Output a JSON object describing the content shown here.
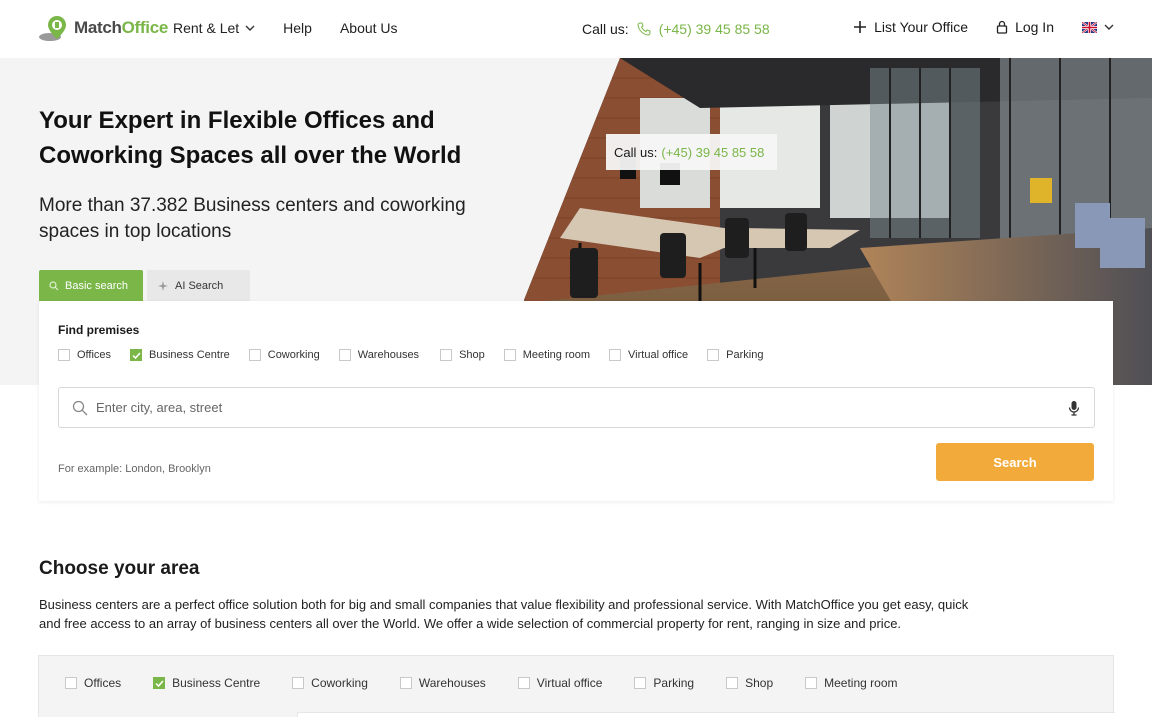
{
  "header": {
    "logo_text": "MatchOffice",
    "nav": [
      {
        "label": "Rent & Let",
        "has_dropdown": true
      },
      {
        "label": "Help",
        "has_dropdown": false
      },
      {
        "label": "About Us",
        "has_dropdown": false
      }
    ],
    "call_label": "Call us:",
    "call_phone": "(+45) 39 45 85 58",
    "list_office": "List Your Office",
    "login": "Log In",
    "language_icon": "uk-flag-icon"
  },
  "hero": {
    "title": "Your Expert in Flexible Offices and Coworking Spaces all over the World",
    "subtitle": "More than 37.382 Business centers and coworking spaces in top locations",
    "floating_call_label": "Call us:",
    "floating_call_phone": "(+45) 39 45 85 58"
  },
  "tabs": {
    "basic": "Basic search",
    "ai": "AI Search"
  },
  "search": {
    "find_label": "Find premises",
    "types": [
      {
        "label": "Offices",
        "checked": false
      },
      {
        "label": "Business Centre",
        "checked": true
      },
      {
        "label": "Coworking",
        "checked": false
      },
      {
        "label": "Warehouses",
        "checked": false
      },
      {
        "label": "Shop",
        "checked": false
      },
      {
        "label": "Meeting room",
        "checked": false
      },
      {
        "label": "Virtual office",
        "checked": false
      },
      {
        "label": "Parking",
        "checked": false
      }
    ],
    "placeholder": "Enter city, area, street",
    "value": "",
    "example": "For example: London, Brooklyn",
    "button": "Search"
  },
  "area": {
    "title": "Choose your area",
    "description": "Business centers are a perfect office solution both for big and small companies that value flexibility and professional service. With MatchOffice you get easy, quick and free access to an array of business centers all over the World. We offer a wide selection of commercial property for rent, ranging in size and price.",
    "types": [
      {
        "label": "Offices",
        "checked": false
      },
      {
        "label": "Business Centre",
        "checked": true
      },
      {
        "label": "Coworking",
        "checked": false
      },
      {
        "label": "Warehouses",
        "checked": false
      },
      {
        "label": "Virtual office",
        "checked": false
      },
      {
        "label": "Parking",
        "checked": false
      },
      {
        "label": "Shop",
        "checked": false
      },
      {
        "label": "Meeting room",
        "checked": false
      }
    ]
  },
  "colors": {
    "brand_green": "#7ab648",
    "search_orange": "#f2ab3a"
  }
}
